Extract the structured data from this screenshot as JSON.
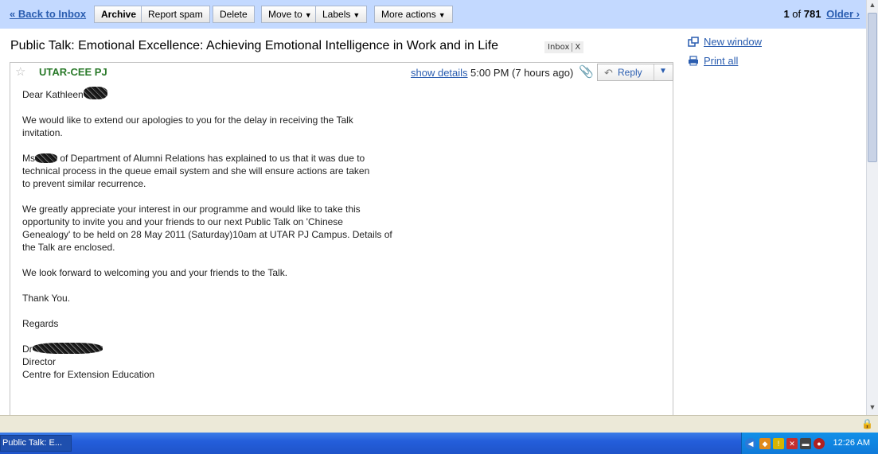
{
  "toolbar": {
    "back_label": "« Back to Inbox",
    "archive_label": "Archive",
    "report_spam_label": "Report spam",
    "delete_label": "Delete",
    "move_to_label": "Move to",
    "labels_label": "Labels",
    "more_actions_label": "More actions",
    "pager_current": "1",
    "pager_of": "of",
    "pager_total": "781",
    "pager_older": "Older ›"
  },
  "subject": {
    "title": "Public Talk: Emotional Excellence: Achieving Emotional Intelligence in Work and in Life",
    "tag": "Inbox",
    "tag_remove": "X"
  },
  "side_actions": {
    "new_window": "New window",
    "print_all": "Print all"
  },
  "message": {
    "sender": "UTAR-CEE PJ",
    "show_details": "show details",
    "time": "5:00 PM (7 hours ago)",
    "reply_label": "Reply",
    "greeting": "Dear Kathleen",
    "para1": "We would like to extend our apologies to you for the delay in receiving the Talk\ninvitation.",
    "para2_prefix": "Ms",
    "para2_rest": " of Department of Alumni Relations has explained to us that it was due to\ntechnical process in the queue email system and she will ensure actions are taken\nto prevent similar recurrence.",
    "para3": "We greatly appreciate your interest in our programme and would like to take this\nopportunity to invite you and your friends to our next Public Talk on 'Chinese\nGenealogy' to be held on 28 May 2011 (Saturday)10am at UTAR PJ Campus. Details of\nthe Talk are enclosed.",
    "para4": "We look forward to welcoming you and your friends to the Talk.",
    "para5": "Thank You.",
    "para6": "Regards",
    "sig_prefix": "Dr",
    "sig_title": "Director",
    "sig_org": "Centre for Extension Education"
  },
  "taskbar": {
    "task_label": "Public Talk: E...",
    "clock": "12:26 AM"
  },
  "colors": {
    "toolbar_bg": "#c3d9ff",
    "link": "#2a5db0",
    "sender": "#2a7a2a",
    "taskbar": "#245edb"
  }
}
